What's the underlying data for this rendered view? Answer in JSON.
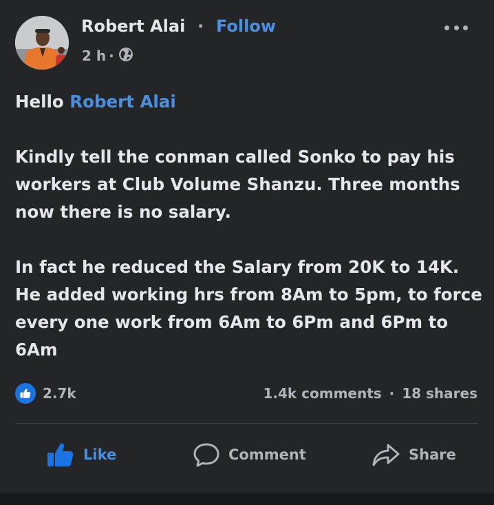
{
  "post": {
    "author": "Robert Alai",
    "separator": "·",
    "follow_label": "Follow",
    "timestamp": "2 h",
    "time_separator": "·",
    "audience_icon": "globe-icon",
    "more_icon": "more-horizontal-icon",
    "body": {
      "greeting": "Hello ",
      "mention": "Robert Alai",
      "paragraph_1": "Kindly tell the conman called Sonko to pay his workers at Club Volume Shanzu. Three months now there is no salary.",
      "paragraph_2": "In fact he reduced the Salary from 20K to 14K. He added working hrs from 8Am to 5pm, to force every one work from 6Am to 6Pm and 6Pm to 6Am"
    },
    "stats": {
      "reaction_icon": "like-reaction-icon",
      "reactions": "2.7k",
      "comments": "1.4k comments",
      "stats_separator": "·",
      "shares": "18 shares"
    },
    "actions": {
      "like_label": "Like",
      "comment_label": "Comment",
      "share_label": "Share"
    }
  },
  "colors": {
    "background": "#242527",
    "text": "#e4e6eb",
    "secondary_text": "#b0b3b8",
    "link_blue": "#4a90e2",
    "like_blue": "#1b74e4"
  }
}
